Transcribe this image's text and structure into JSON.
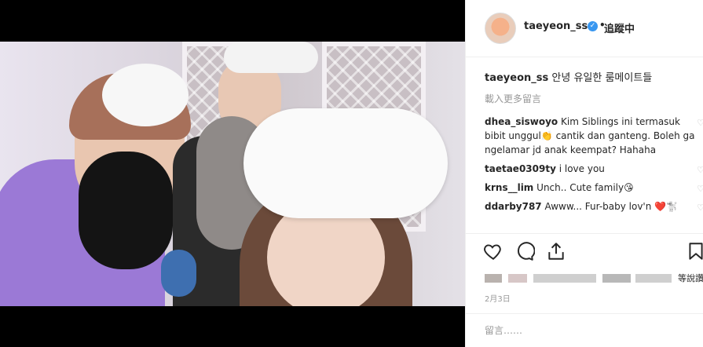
{
  "post": {
    "username": "taeyeon_ss",
    "verified_icon": "verified-badge-icon",
    "separator": "•",
    "follow_status": "追蹤中"
  },
  "caption": {
    "username": "taeyeon_ss",
    "text": "안녕 유일한 룸메이트들"
  },
  "load_more": "載入更多留言",
  "comments": [
    {
      "username": "dhea_siswoyo",
      "text": "Kim Siblings ini termasuk bibit unggul👏 cantik dan ganteng. Boleh ga ngelamar jd anak keempat? Hahaha"
    },
    {
      "username": "taetae0309ty",
      "text": "i love you"
    },
    {
      "username": "krns__lim",
      "text": "Unch.. Cute family😘"
    },
    {
      "username": "ddarby787",
      "text": "Awww... Fur-baby lov'n ❤️🐩"
    }
  ],
  "likes_suffix": "等說讚",
  "date": "2月3日",
  "add_comment_placeholder": "留言……",
  "icons": {
    "like": "heart-icon",
    "comment": "comment-icon",
    "share": "share-icon",
    "save": "bookmark-icon"
  },
  "colors": {
    "verified": "#3897f0",
    "text": "#262626",
    "muted": "#999999",
    "border": "#efefef"
  }
}
